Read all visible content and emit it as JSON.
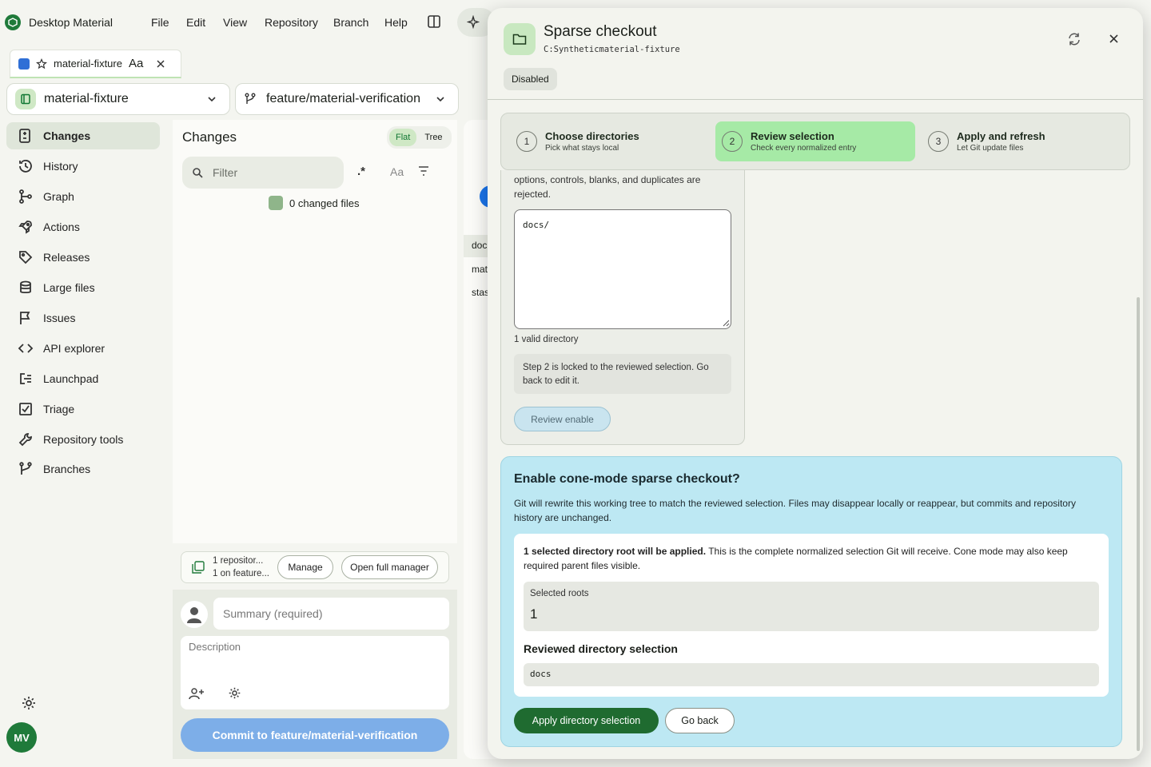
{
  "app": {
    "title": "Desktop Material"
  },
  "menu": [
    "File",
    "Edit",
    "View",
    "Repository",
    "Branch",
    "Help"
  ],
  "tab": {
    "label": "material-fixture",
    "font_toggle": "Aa"
  },
  "repo_selector": {
    "label": "material-fixture"
  },
  "branch_selector": {
    "label": "feature/material-verification"
  },
  "sidebar": {
    "items": [
      {
        "label": "Changes",
        "icon": "changes-icon",
        "active": true
      },
      {
        "label": "History",
        "icon": "history-icon"
      },
      {
        "label": "Graph",
        "icon": "graph-icon"
      },
      {
        "label": "Actions",
        "icon": "rocket-icon"
      },
      {
        "label": "Releases",
        "icon": "tag-icon"
      },
      {
        "label": "Large files",
        "icon": "database-icon"
      },
      {
        "label": "Issues",
        "icon": "flag-icon"
      },
      {
        "label": "API explorer",
        "icon": "code-icon"
      },
      {
        "label": "Launchpad",
        "icon": "launchpad-icon"
      },
      {
        "label": "Triage",
        "icon": "triage-icon"
      },
      {
        "label": "Repository tools",
        "icon": "wrench-icon"
      },
      {
        "label": "Branches",
        "icon": "branch-icon"
      }
    ],
    "avatar_initials": "MV"
  },
  "changes": {
    "title": "Changes",
    "view_flat": "Flat",
    "view_tree": "Tree",
    "filter_placeholder": "Filter",
    "regex_label": ".*",
    "case_label": "Aa",
    "changed_files": "0 changed files",
    "repo_summary_line1": "1 repositor...",
    "repo_summary_line2": "1 on feature...",
    "manage_label": "Manage",
    "open_manager_label": "Open full manager",
    "summary_placeholder": "Summary (required)",
    "description_placeholder": "Description",
    "commit_label": "Commit to feature/material-verification"
  },
  "background_list": [
    "doc",
    "mat",
    "stas"
  ],
  "dialog": {
    "title": "Sparse checkout",
    "path": "C:Syntheticmaterial-fixture",
    "status": "Disabled",
    "steps": [
      {
        "num": "1",
        "title": "Choose directories",
        "subtitle": "Pick what stays local"
      },
      {
        "num": "2",
        "title": "Review selection",
        "subtitle": "Check every normalized entry",
        "active": true
      },
      {
        "num": "3",
        "title": "Apply and refresh",
        "subtitle": "Let Git update files"
      }
    ],
    "intro_text": "options, controls, blanks, and duplicates are rejected.",
    "textarea_value": "docs/",
    "valid_count": "1 valid directory",
    "locked_note": "Step 2 is locked to the reviewed selection. Go back to edit it.",
    "review_enable_label": "Review enable",
    "confirm": {
      "title": "Enable cone-mode sparse checkout?",
      "body": "Git will rewrite this working tree to match the reviewed selection. Files may disappear locally or reappear, but commits and repository history are unchanged.",
      "summary_bold": "1 selected directory root will be applied.",
      "summary_rest": " This is the complete normalized selection Git will receive. Cone mode may also keep required parent files visible.",
      "roots_label": "Selected roots",
      "roots_value": "1",
      "reviewed_heading": "Reviewed directory selection",
      "reviewed_item": "docs",
      "apply_label": "Apply directory selection",
      "back_label": "Go back"
    }
  }
}
